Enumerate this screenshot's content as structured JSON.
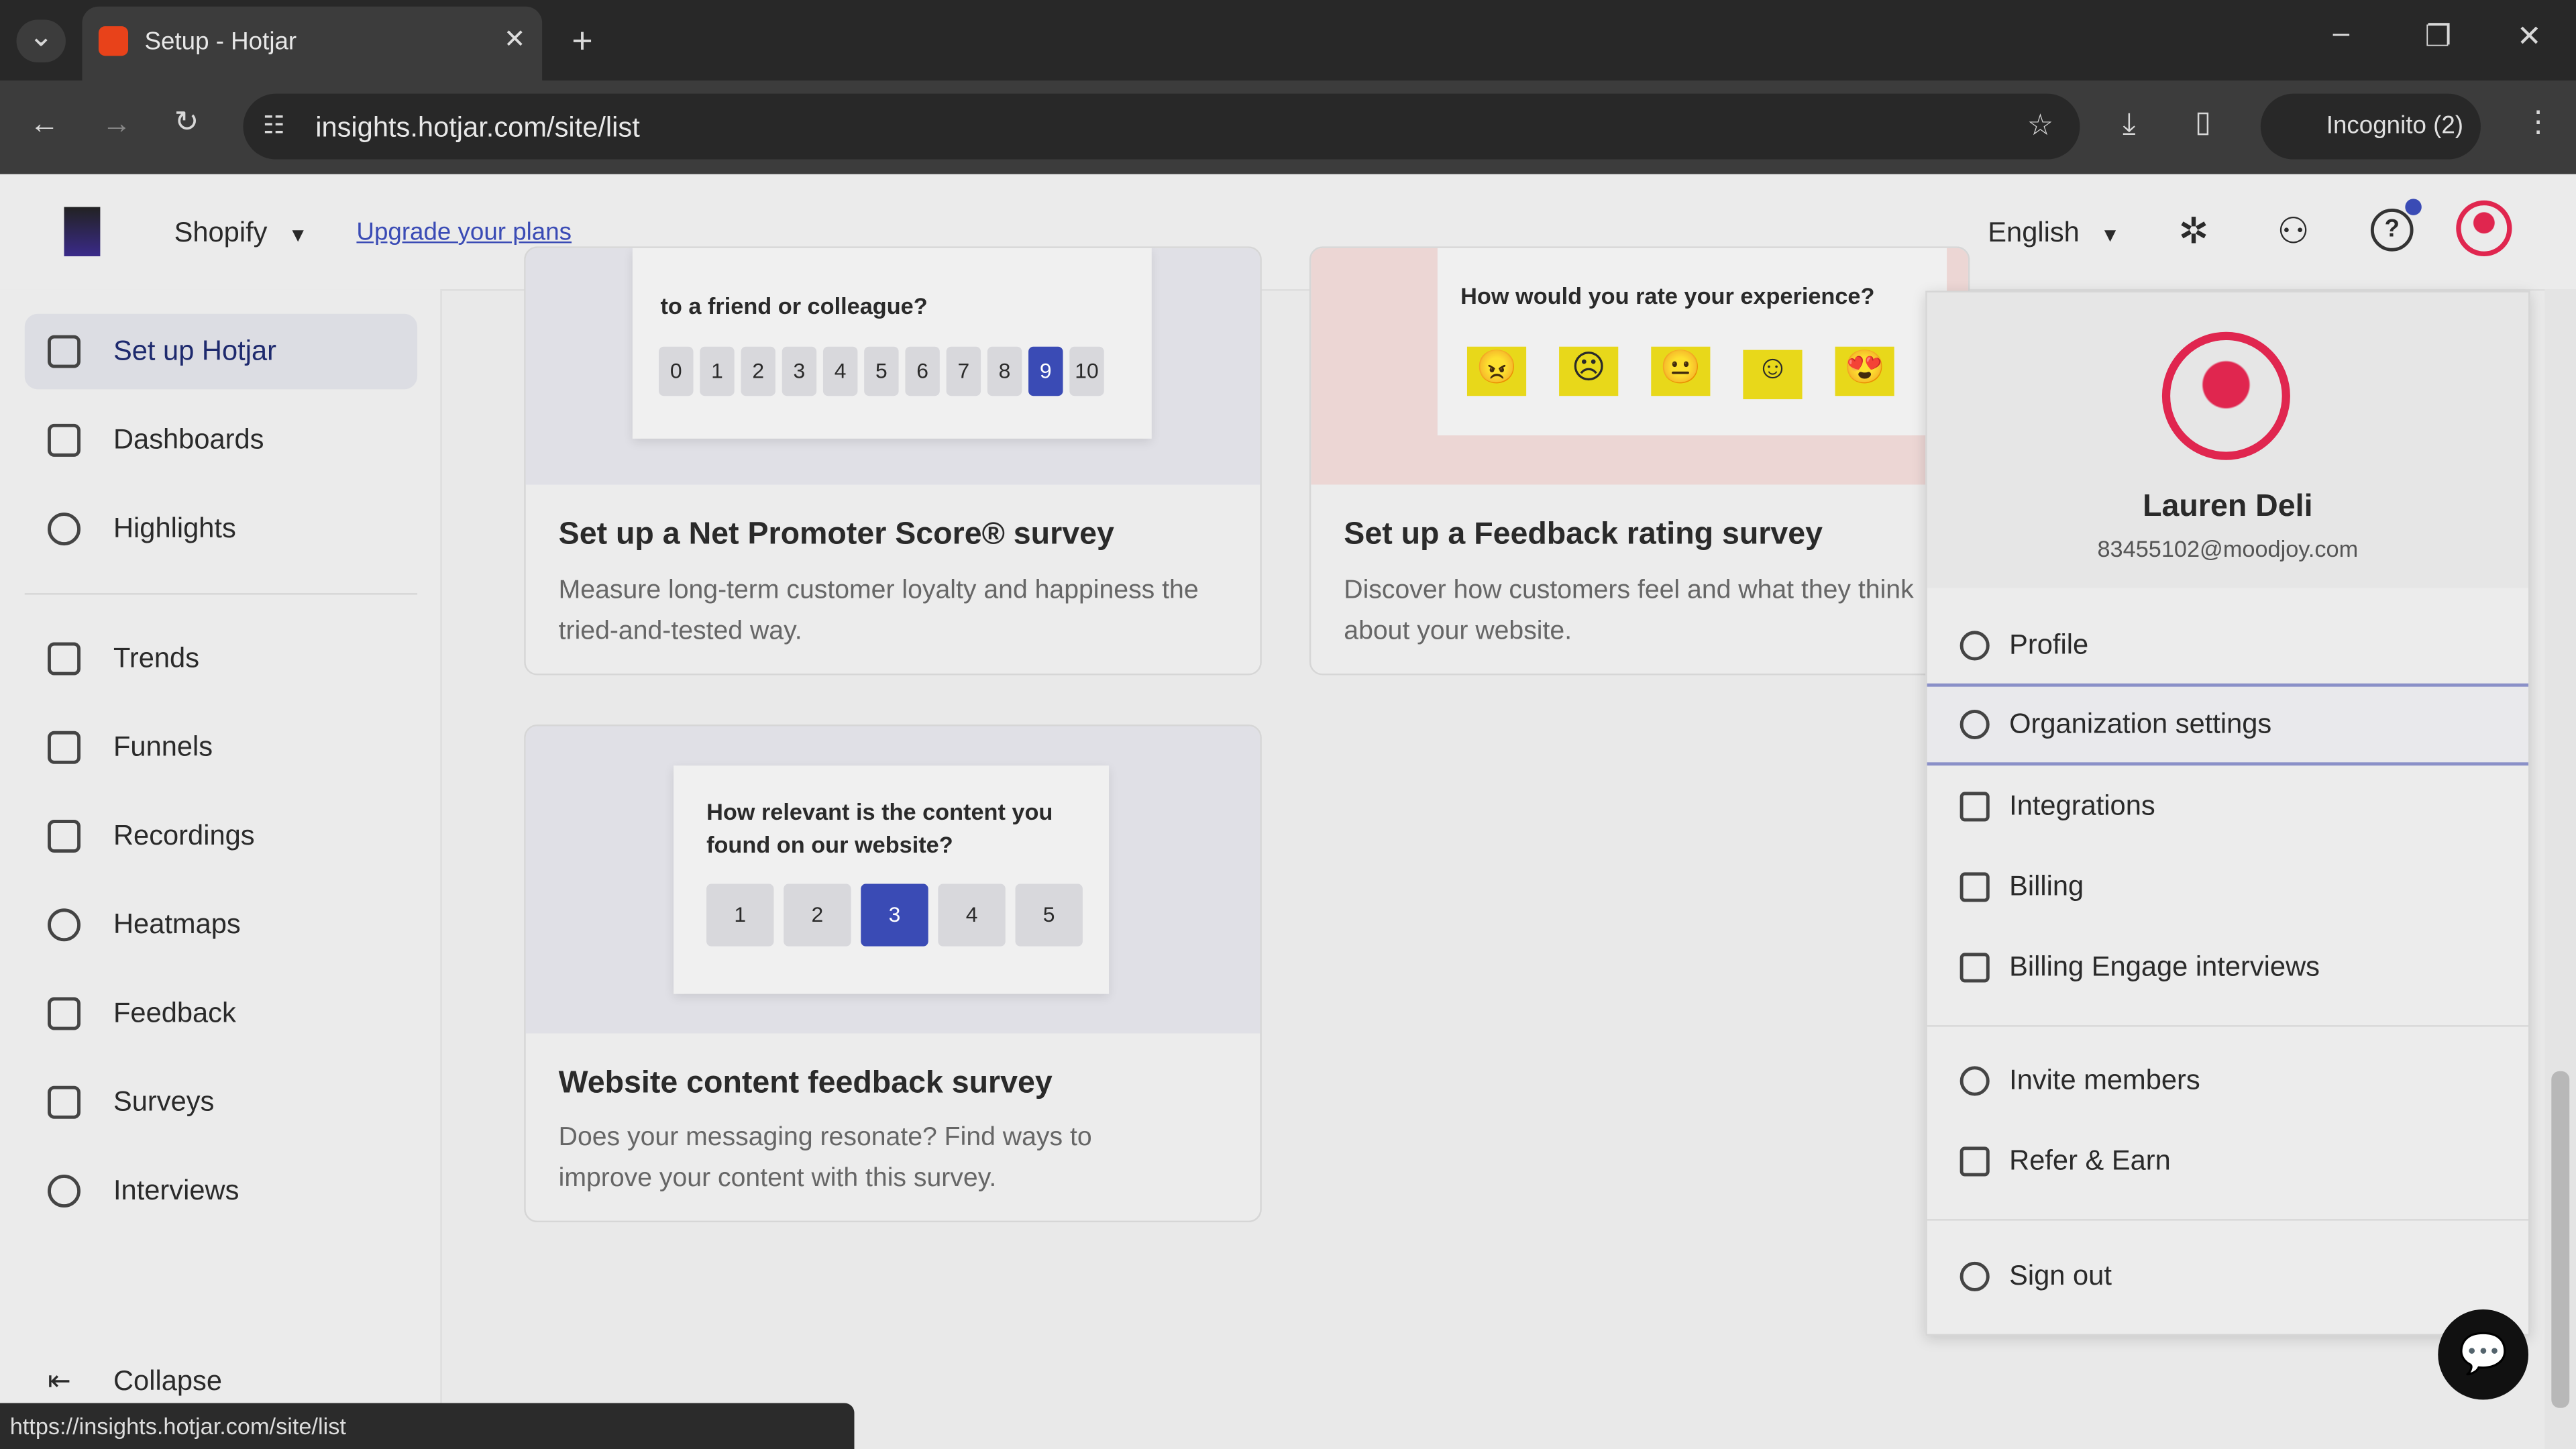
{
  "browser": {
    "tab_title": "Setup - Hotjar",
    "url": "insights.hotjar.com/site/list",
    "incognito": "Incognito (2)",
    "status_url": "https://insights.hotjar.com/site/list"
  },
  "header": {
    "site": "Shopify",
    "upgrade": "Upgrade your plans",
    "language": "English"
  },
  "sidebar": {
    "items": [
      {
        "label": "Set up Hotjar",
        "active": true
      },
      {
        "label": "Dashboards"
      },
      {
        "label": "Highlights"
      },
      {
        "label": "Trends"
      },
      {
        "label": "Funnels"
      },
      {
        "label": "Recordings"
      },
      {
        "label": "Heatmaps"
      },
      {
        "label": "Feedback"
      },
      {
        "label": "Surveys"
      },
      {
        "label": "Interviews"
      }
    ],
    "collapse": "Collapse"
  },
  "cards": [
    {
      "preview_q": "to a friend or colleague?",
      "scale": [
        "0",
        "1",
        "2",
        "3",
        "4",
        "5",
        "6",
        "7",
        "8",
        "9",
        "10"
      ],
      "selected": "9",
      "title": "Set up a Net Promoter Score® survey",
      "desc": "Measure long-term customer loyalty and happiness the tried-and-tested way."
    },
    {
      "preview_q": "How would you rate your experience?",
      "title": "Set up a Feedback rating survey",
      "desc": "Discover how customers feel and what they think about your website."
    },
    {
      "preview_q": "How relevant is the content you found on our website?",
      "scale": [
        "1",
        "2",
        "3",
        "4",
        "5"
      ],
      "selected": "3",
      "title": "Website content feedback survey",
      "desc": "Does your messaging resonate? Find ways to improve your content with this survey."
    }
  ],
  "user_menu": {
    "name": "Lauren Deli",
    "email": "83455102@moodjoy.com",
    "items": [
      "Profile",
      "Organization settings",
      "Integrations",
      "Billing",
      "Billing Engage interviews",
      "Invite members",
      "Refer & Earn",
      "Sign out"
    ]
  },
  "colors": {
    "accent": "#3a4bb5",
    "avatar": "#e0264f",
    "emoji": "#e8d81a"
  }
}
